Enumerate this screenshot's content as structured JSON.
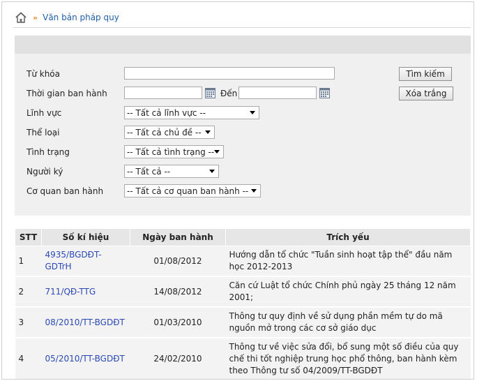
{
  "breadcrumb": {
    "current": "Văn bản pháp quy"
  },
  "form": {
    "keyword_label": "Từ khóa",
    "time_label": "Thời gian ban hành",
    "to_label": "Đến",
    "field_label": "Lĩnh vực",
    "field_value": "-- Tất cả lĩnh vực --",
    "type_label": "Thể loại",
    "type_value": "-- Tất cả chủ đề --",
    "status_label": "Tình trạng",
    "status_value": "-- Tất cả tình trạng --",
    "signer_label": "Người ký",
    "signer_value": "-- Tất cả --",
    "agency_label": "Cơ quan ban hành",
    "agency_value": "-- Tất cả cơ quan ban hành --",
    "search_button": "Tìm kiếm",
    "clear_button": "Xóa trắng"
  },
  "table": {
    "headers": [
      "STT",
      "Số kí hiệu",
      "Ngày ban hành",
      "Trích yếu"
    ],
    "rows": [
      {
        "stt": "1",
        "so": "4935/BGDĐT-GDTrH",
        "ngay": "01/08/2012",
        "trich_yeu": "Hướng dẫn tổ chức \"Tuần sinh hoạt tập thể\" đầu năm học 2012-2013"
      },
      {
        "stt": "2",
        "so": "711/QĐ-TTG",
        "ngay": "14/08/2012",
        "trich_yeu": "Căn cứ Luật tổ chức Chính phủ ngày 25 tháng 12 năm 2001;"
      },
      {
        "stt": "3",
        "so": "08/2010/TT-BGDĐT",
        "ngay": "01/03/2010",
        "trich_yeu": "Thông tư quy định về sử dụng phần mềm tự do mã nguồn mở trong các cơ sở giáo dục"
      },
      {
        "stt": "4",
        "so": "05/2010/TT-BGDĐT",
        "ngay": "24/02/2010",
        "trich_yeu": "Thông tư về việc sửa đổi, bổ sung một số điều của quy chế thi tốt nghiệp trung học phổ thông, ban hành kèm theo Thông tư số 04/2009/TT-BGDĐT"
      }
    ]
  }
}
